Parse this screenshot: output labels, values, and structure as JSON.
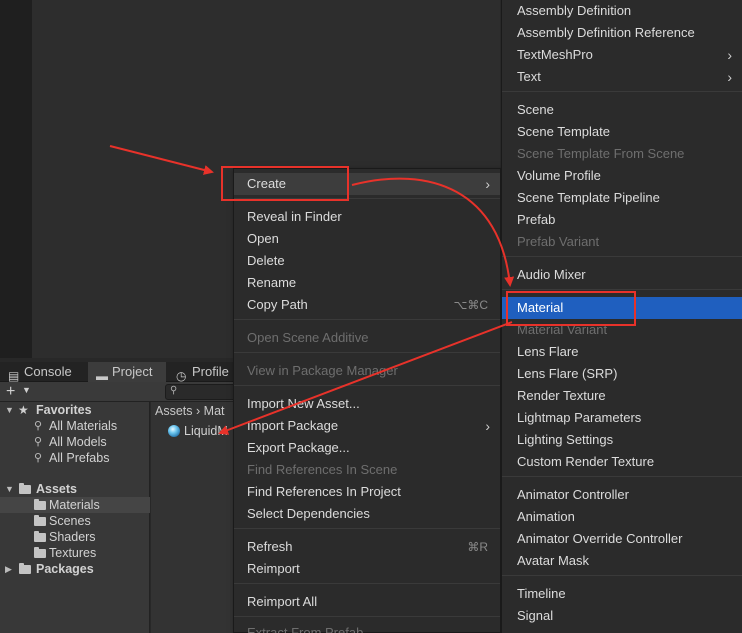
{
  "tabs": [
    {
      "label": "Console",
      "icon": "console-icon"
    },
    {
      "label": "Project",
      "icon": "folder-icon"
    },
    {
      "label": "Profile",
      "icon": "profiler-icon"
    }
  ],
  "toolbar": {
    "add_label": "+"
  },
  "tree": {
    "favorites_label": "Favorites",
    "favorites": [
      "All Materials",
      "All Models",
      "All Prefabs"
    ],
    "assets_label": "Assets",
    "assets_children": [
      "Materials",
      "Scenes",
      "Shaders",
      "Textures"
    ],
    "packages_label": "Packages"
  },
  "breadcrumb": {
    "root": "Assets",
    "sep": "›",
    "current": "Mat"
  },
  "asset": {
    "name": "LiquidM"
  },
  "context_menu": {
    "create": "Create",
    "reveal": "Reveal in Finder",
    "open": "Open",
    "delete": "Delete",
    "rename": "Rename",
    "copy_path": "Copy Path",
    "copy_path_shortcut": "⌥⌘C",
    "open_scene_additive": "Open Scene Additive",
    "view_in_package_manager": "View in Package Manager",
    "import_new_asset": "Import New Asset...",
    "import_package": "Import Package",
    "export_package": "Export Package...",
    "find_refs_scene": "Find References In Scene",
    "find_refs_project": "Find References In Project",
    "select_dependencies": "Select Dependencies",
    "refresh": "Refresh",
    "refresh_shortcut": "⌘R",
    "reimport": "Reimport",
    "reimport_all": "Reimport All",
    "extract_from_prefab": "Extract From Prefab"
  },
  "submenu": {
    "assembly_definition": "Assembly Definition",
    "assembly_definition_reference": "Assembly Definition Reference",
    "textmeshpro": "TextMeshPro",
    "text": "Text",
    "scene": "Scene",
    "scene_template": "Scene Template",
    "scene_template_from_scene": "Scene Template From Scene",
    "volume_profile": "Volume Profile",
    "scene_template_pipeline": "Scene Template Pipeline",
    "prefab": "Prefab",
    "prefab_variant": "Prefab Variant",
    "audio_mixer": "Audio Mixer",
    "material": "Material",
    "material_variant": "Material Variant",
    "lens_flare": "Lens Flare",
    "lens_flare_srp": "Lens Flare (SRP)",
    "render_texture": "Render Texture",
    "lightmap_parameters": "Lightmap Parameters",
    "lighting_settings": "Lighting Settings",
    "custom_render_texture": "Custom Render Texture",
    "animator_controller": "Animator Controller",
    "animation": "Animation",
    "animator_override_controller": "Animator Override Controller",
    "avatar_mask": "Avatar Mask",
    "timeline": "Timeline",
    "signal": "Signal"
  },
  "colors": {
    "highlight": "#1f5fbf",
    "annotation": "#e8322a"
  }
}
